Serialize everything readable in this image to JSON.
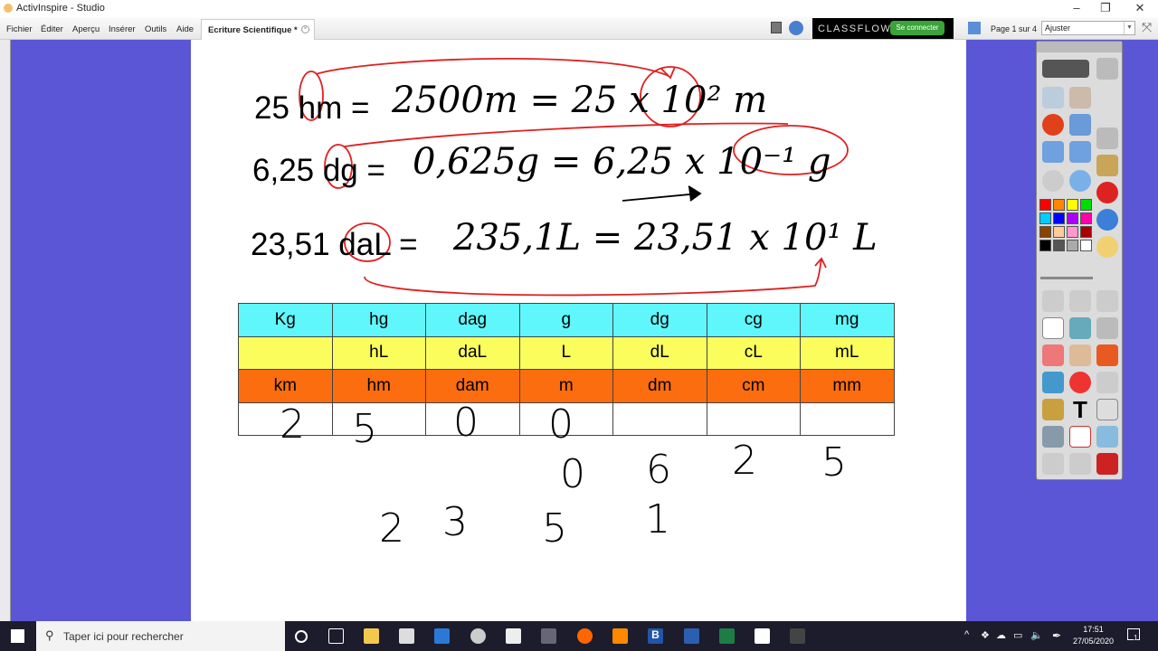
{
  "window": {
    "title": "ActivInspire - Studio"
  },
  "menu": [
    "Fichier",
    "Éditer",
    "Aperçu",
    "Insérer",
    "Outils",
    "Aide"
  ],
  "tab": {
    "label": "Ecriture Scientifique *"
  },
  "classflow": {
    "brand": "CLASSFLOW",
    "connect": "Se connecter"
  },
  "page": {
    "indicator": "Page 1 sur 4",
    "zoom": "Ajuster"
  },
  "equations": [
    {
      "typed": "25 hm =",
      "handwritten": "2500m = 25 x 10² m"
    },
    {
      "typed": "6,25 dg =",
      "handwritten": "0,625g = 6,25 x 10⁻¹ g"
    },
    {
      "typed": "23,51 daL =",
      "handwritten": "235,1L = 23,51 x 10¹ L"
    }
  ],
  "table": {
    "rows": [
      [
        "Kg",
        "hg",
        "dag",
        "g",
        "dg",
        "cg",
        "mg"
      ],
      [
        "",
        "hL",
        "daL",
        "L",
        "dL",
        "cL",
        "mL"
      ],
      [
        "km",
        "hm",
        "dam",
        "m",
        "dm",
        "cm",
        "mm"
      ]
    ],
    "handwritten_digits": [
      "2",
      "5",
      "0",
      "0",
      "0",
      "6",
      "2",
      "5",
      "2",
      "3",
      "5",
      "1"
    ]
  },
  "taskbar": {
    "search_placeholder": "Taper ici pour rechercher",
    "time": "17:51",
    "date": "27/05/2020",
    "notifications": "1"
  },
  "colors": {
    "background": "#5a56d6",
    "annotation": "#e02020",
    "cyan": "#5ff7fb",
    "yellow": "#fafd5c",
    "orange": "#fb6d0e"
  }
}
